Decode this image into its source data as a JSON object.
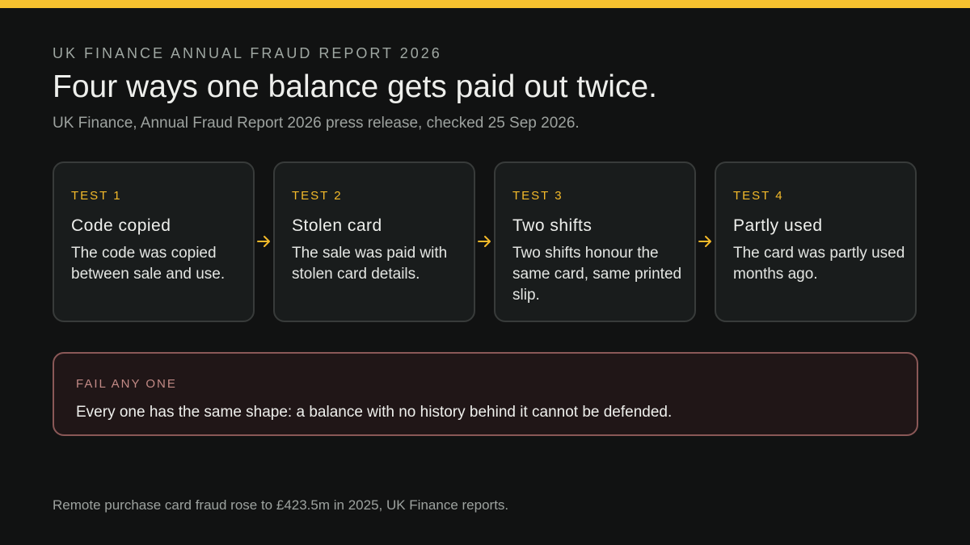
{
  "kicker": "UK FINANCE ANNUAL FRAUD REPORT 2026",
  "headline": "Four ways one balance gets paid out twice.",
  "source": "UK Finance, Annual Fraud Report 2026 press release, checked 25 Sep 2026.",
  "cards": [
    {
      "kicker": "TEST 1",
      "title": "Code copied",
      "body": "The code was copied between sale and use."
    },
    {
      "kicker": "TEST 2",
      "title": "Stolen card",
      "body": "The sale was paid with stolen card details."
    },
    {
      "kicker": "TEST 3",
      "title": "Two shifts",
      "body": "Two shifts honour the same card, same printed slip."
    },
    {
      "kicker": "TEST 4",
      "title": "Partly used",
      "body": "The card was partly used months ago."
    }
  ],
  "fail": {
    "kicker": "FAIL ANY ONE",
    "text": "Every one has the same shape: a balance with no history behind it cannot be defended."
  },
  "footer": "Remote purchase card fraud rose to £423.5m in 2025, UK Finance reports.",
  "colors": {
    "background": "#111212",
    "accent": "#F7C12F",
    "card_border": "#383B3A",
    "fail_border": "#8A5857"
  },
  "icons": {
    "connector": "arrow-right-icon"
  }
}
